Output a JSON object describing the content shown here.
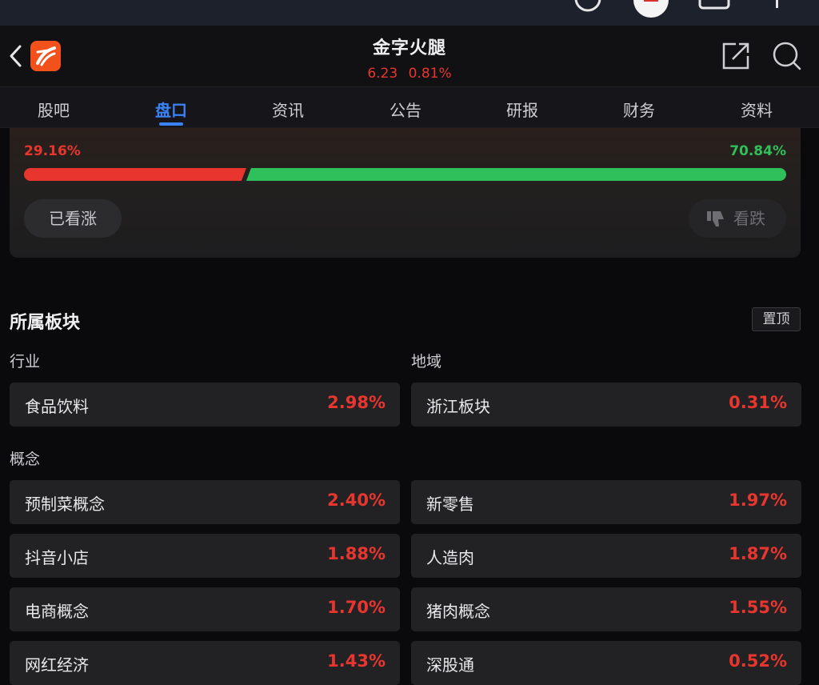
{
  "header": {
    "stock_name": "金字火腿",
    "price": "6.23",
    "change_pct": "0.81%"
  },
  "tabs": [
    "股吧",
    "盘口",
    "资讯",
    "公告",
    "研报",
    "财务",
    "资料"
  ],
  "active_tab": "盘口",
  "vote": {
    "up_pct_label": "29.16%",
    "down_pct_label": "70.84%",
    "up_fraction": 0.2916,
    "up_button": "已看涨",
    "down_button": "看跌"
  },
  "plates": {
    "title": "所属板块",
    "pin_label": "置顶",
    "industry_label": "行业",
    "region_label": "地域",
    "concept_label": "概念",
    "industry": {
      "name": "食品饮料",
      "change": "2.98%"
    },
    "region": {
      "name": "浙江板块",
      "change": "0.31%"
    },
    "concepts": [
      {
        "name": "预制菜概念",
        "change": "2.40%"
      },
      {
        "name": "新零售",
        "change": "1.97%"
      },
      {
        "name": "抖音小店",
        "change": "1.88%"
      },
      {
        "name": "人造肉",
        "change": "1.87%"
      },
      {
        "name": "电商概念",
        "change": "1.70%"
      },
      {
        "name": "猪肉概念",
        "change": "1.55%"
      },
      {
        "name": "网红经济",
        "change": "1.43%"
      },
      {
        "name": "深股通",
        "change": "0.52%"
      }
    ]
  },
  "colors": {
    "up_red": "#e8362f",
    "down_green": "#2fbf5b",
    "accent_blue": "#3b82f6"
  }
}
